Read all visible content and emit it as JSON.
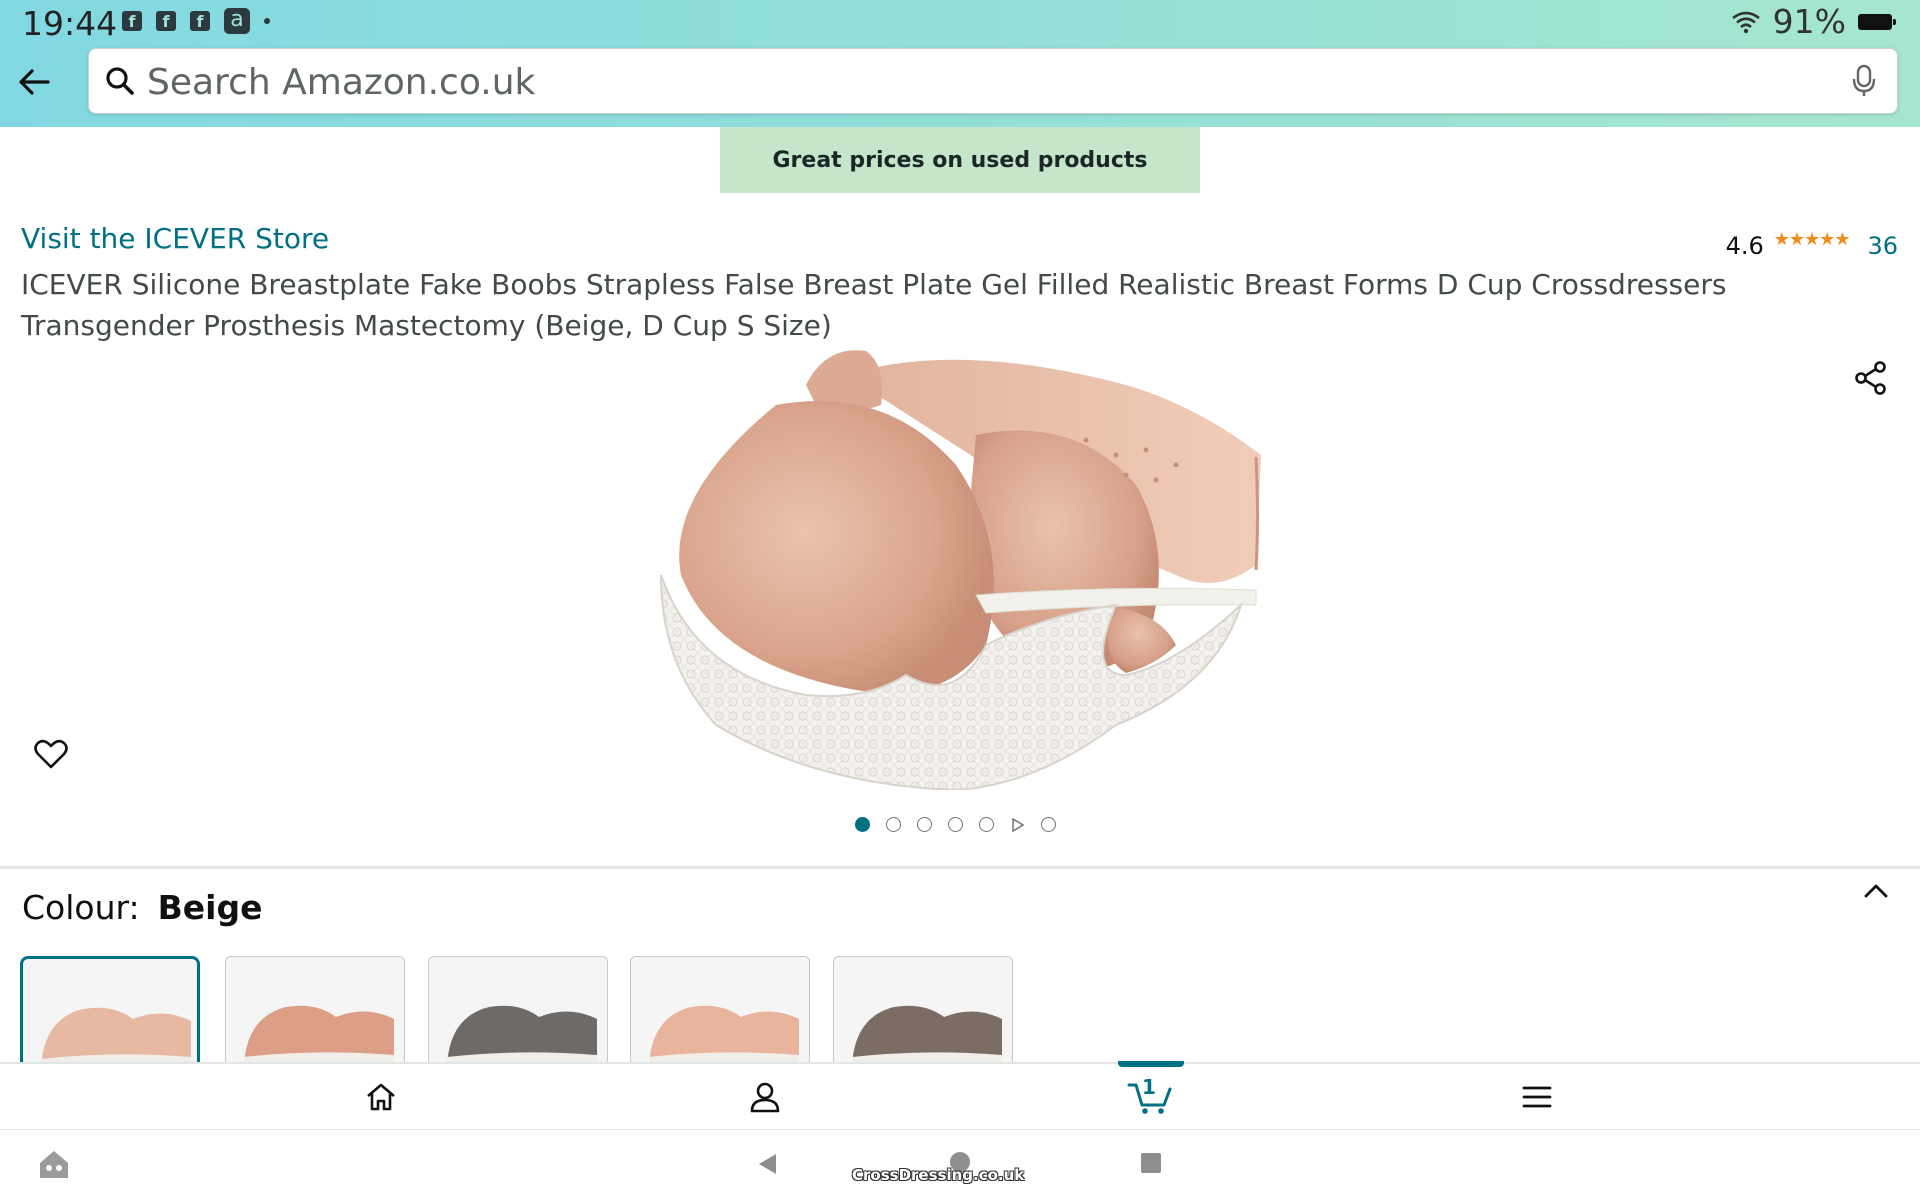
{
  "status_bar": {
    "time": "19:44",
    "battery": "91%",
    "notification_icons": [
      "facebook-icon",
      "facebook-icon",
      "facebook-icon",
      "amazon-app-icon",
      "dot-icon"
    ]
  },
  "search": {
    "placeholder": "Search Amazon.co.uk"
  },
  "promo": {
    "text": "Great prices on used products"
  },
  "product": {
    "store_link": "Visit the ICEVER Store",
    "rating": "4.6",
    "stars": "★★★★★",
    "review_count": "36",
    "title": "ICEVER Silicone Breastplate Fake Boobs Strapless False Breast Plate Gel Filled Realistic Breast Forms D Cup Crossdressers Transgender Prosthesis Mastectomy (Beige, D Cup S Size)",
    "image_count": 7,
    "active_image_index": 0
  },
  "variations": {
    "label": "Colour:",
    "selected": "Beige",
    "swatches": [
      {
        "name": "Beige",
        "color": "#e7b8a2",
        "lace": true,
        "selected": true
      },
      {
        "name": "Tan",
        "color": "#dc9f86",
        "lace": true,
        "selected": false
      },
      {
        "name": "Grey",
        "color": "#6d6a68",
        "lace": true,
        "selected": false
      },
      {
        "name": "Light Tan",
        "color": "#e8b49c",
        "lace": true,
        "selected": false
      },
      {
        "name": "Brown",
        "color": "#7c6d64",
        "lace": true,
        "selected": false
      }
    ]
  },
  "bottom_nav": {
    "items": [
      "home-icon",
      "account-icon",
      "cart-icon",
      "menu-icon"
    ],
    "cart_count": "1",
    "active": "cart"
  },
  "system_nav": {
    "watermark": "CrossDressing.co.uk"
  },
  "colors": {
    "accent": "#007185",
    "promo_bg": "#c6e6cc",
    "star": "#f08c1c"
  }
}
